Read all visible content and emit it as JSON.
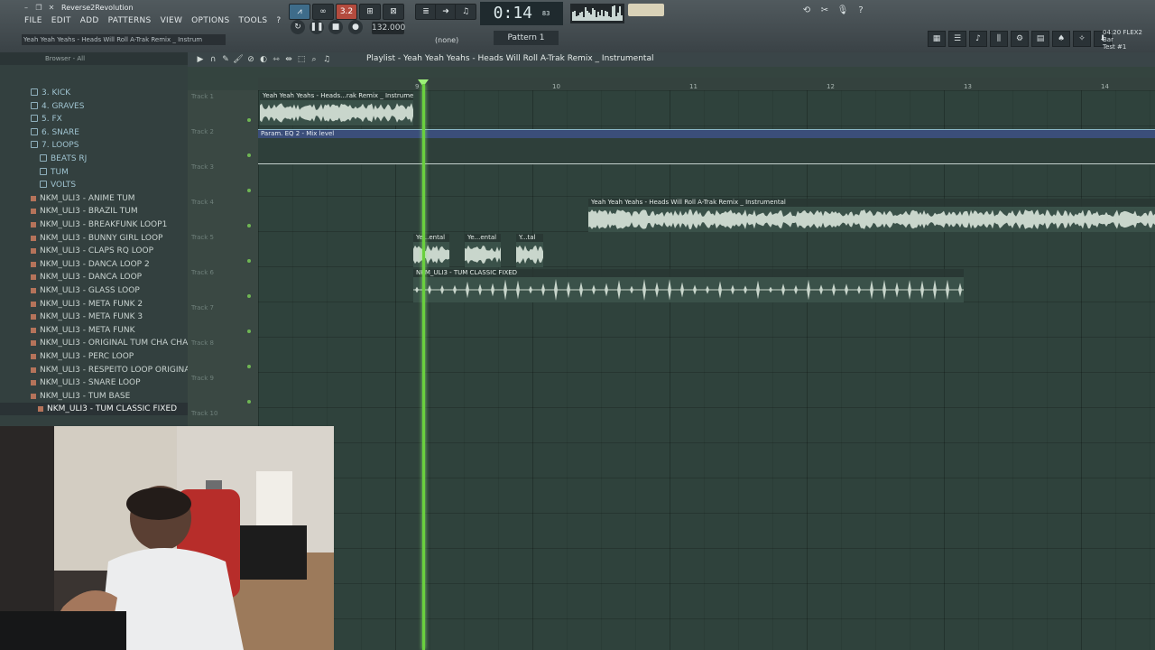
{
  "window": {
    "project": "Reverse2Revolution",
    "hint": "Yeah Yeah Yeahs - Heads Will Roll A-Trak Remix _ Instrum"
  },
  "menu": [
    "FILE",
    "EDIT",
    "ADD",
    "PATTERNS",
    "VIEW",
    "OPTIONS",
    "TOOLS",
    "?"
  ],
  "transport": {
    "tempo": "132.000",
    "time": "0:14",
    "time_ms": "83",
    "time_unit": "M:S:CS",
    "pattern": "Pattern 1",
    "none": "(none)",
    "badge": "3.2"
  },
  "topright": {
    "line1": "04:20 FLEX2 Bar",
    "line2": "Test #1"
  },
  "browser": {
    "header": "Browser - All",
    "items": [
      {
        "label": "3. KICK",
        "type": "folder"
      },
      {
        "label": "4. GRAVES",
        "type": "folder"
      },
      {
        "label": "5. FX",
        "type": "folder"
      },
      {
        "label": "6. SNARE",
        "type": "folder"
      },
      {
        "label": "7. LOOPS",
        "type": "folder"
      },
      {
        "label": "BEATS RJ",
        "type": "subfolder"
      },
      {
        "label": "TUM",
        "type": "subfolder"
      },
      {
        "label": "VOLTS",
        "type": "subfolder"
      },
      {
        "label": "NKM_ULI3 - ANIME TUM",
        "type": "file"
      },
      {
        "label": "NKM_ULI3 - BRAZIL TUM",
        "type": "file"
      },
      {
        "label": "NKM_ULI3 - BREAKFUNK LOOP1",
        "type": "file"
      },
      {
        "label": "NKM_ULI3 - BUNNY GIRL LOOP",
        "type": "file"
      },
      {
        "label": "NKM_ULI3 - CLAPS RQ LOOP",
        "type": "file"
      },
      {
        "label": "NKM_ULI3 - DANCA LOOP 2",
        "type": "file"
      },
      {
        "label": "NKM_ULI3 - DANCA LOOP",
        "type": "file"
      },
      {
        "label": "NKM_ULI3 - GLASS LOOP",
        "type": "file"
      },
      {
        "label": "NKM_ULI3 - META FUNK 2",
        "type": "file"
      },
      {
        "label": "NKM_ULI3 - META FUNK 3",
        "type": "file"
      },
      {
        "label": "NKM_ULI3 - META FUNK",
        "type": "file"
      },
      {
        "label": "NKM_ULI3 - ORIGINAL TUM CHA CHA",
        "type": "file"
      },
      {
        "label": "NKM_ULI3 - PERC LOOP",
        "type": "file"
      },
      {
        "label": "NKM_ULI3 - RESPEITO LOOP ORIGINAL",
        "type": "file"
      },
      {
        "label": "NKM_ULI3 - SNARE LOOP",
        "type": "file"
      },
      {
        "label": "NKM_ULI3 - TUM BASE",
        "type": "file"
      },
      {
        "label": "NKM_ULI3 - TUM CLASSIC FIXED",
        "type": "file",
        "selected": true
      }
    ]
  },
  "playlist": {
    "title": "Playlist - Yeah Yeah Yeahs - Heads Will Roll A-Trak Remix _ Instrumental",
    "ruler": [
      "9",
      "10",
      "11",
      "12",
      "13",
      "14"
    ],
    "tracks": [
      "Track 1",
      "Track 2",
      "Track 3",
      "Track 4",
      "Track 5",
      "Track 6",
      "Track 7",
      "Track 8",
      "Track 9",
      "Track 10"
    ],
    "clips": {
      "c1": "Yeah Yeah Yeahs - Heads...rak Remix _ Instrumental",
      "c2": "Param. EQ 2 - Mix level",
      "c3": "Yeah Yeah Yeahs - Heads Will Roll A-Trak Remix _ Instrumental",
      "c4a": "Ye...ental",
      "c4b": "Ye...ental",
      "c4c": "Y...tal",
      "c5": "NKM_ULI3 - TUM CLASSIC FIXED"
    }
  },
  "colors": {
    "playhead": "#6ad03e",
    "grid": "#2f423c",
    "clip_wave": "#c9d6cc"
  }
}
